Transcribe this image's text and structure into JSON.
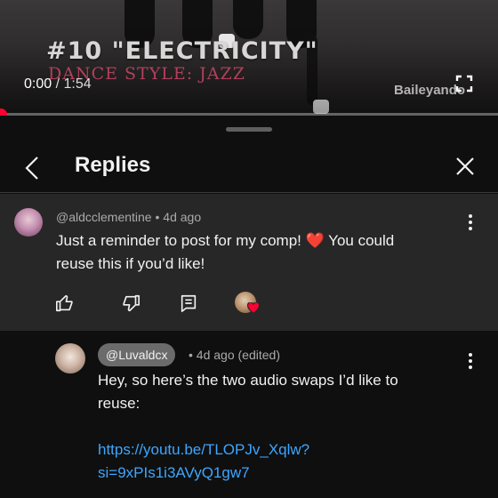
{
  "video": {
    "title_overlay": "#10 \"ELECTRICITY\"",
    "subtitle_overlay": "DANCE STYLE: JAZZ",
    "current_time": "0:00",
    "time_separator": " / ",
    "duration": "1:54",
    "watermark": "Baileyando",
    "progress_percent": 0,
    "progress_color": "#ff0033"
  },
  "panel": {
    "title": "Replies",
    "back_icon": "chevron-left-icon",
    "close_icon": "close-icon"
  },
  "parent_comment": {
    "author": "@aldcclementine",
    "separator": " • ",
    "time": "4d ago",
    "text_line1": "Just a reminder to post for my comp! ❤️  You could",
    "text_line2": "reuse this if you’d like!",
    "actions": [
      "like-icon",
      "dislike-icon",
      "reply-icon"
    ],
    "creator_heart": true
  },
  "reply_comment": {
    "author": "@Luvaldcx",
    "separator": " • ",
    "time": "4d ago (edited)",
    "text_line1": "Hey, so here’s the two audio swaps I’d like to",
    "text_line2": "reuse:",
    "link_line1": "https://youtu.be/TLOPJv_Xqlw?",
    "link_line2": "si=9xPIs1i3AVyQ1gw7",
    "link_color": "#3ea6ff"
  },
  "colors": {
    "background": "#0f0f0f",
    "highlight_row": "#272727",
    "accent_red": "#ff0033"
  }
}
